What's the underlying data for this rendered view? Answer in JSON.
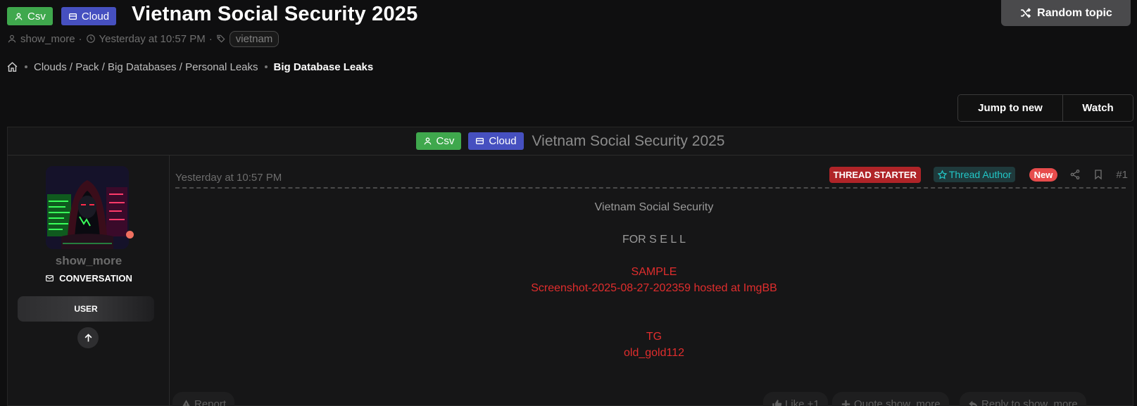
{
  "header": {
    "badges": [
      {
        "label": "Csv",
        "color": "#3fa84d",
        "icon": "user-icon"
      },
      {
        "label": "Cloud",
        "color": "#4650c0",
        "icon": "storage-icon"
      }
    ],
    "title": "Vietnam Social Security 2025",
    "random_topic_label": "Random topic"
  },
  "meta": {
    "author": "show_more",
    "separator": "·",
    "date": "Yesterday at 10:57 PM",
    "tag": "vietnam"
  },
  "breadcrumb": {
    "parent": "Clouds / Pack / Big Databases / Personal Leaks",
    "current": "Big Database Leaks"
  },
  "actions": {
    "jump_to_new": "Jump to new",
    "watch": "Watch"
  },
  "thread": {
    "badges": [
      {
        "label": "Csv",
        "color": "#3fa84d"
      },
      {
        "label": "Cloud",
        "color": "#4650c0"
      }
    ],
    "title": "Vietnam Social Security 2025"
  },
  "user": {
    "name": "show_more",
    "conversation_label": "CONVERSATION",
    "role": "USER",
    "status_color": "#f07060"
  },
  "post": {
    "date": "Yesterday at 10:57 PM",
    "thread_starter": "THREAD STARTER",
    "thread_author": "Thread Author",
    "new_label": "New",
    "number": "#1",
    "body": {
      "line1": "Vietnam Social Security",
      "line2": "FOR S E L L",
      "line3": "SAMPLE",
      "line4": "Screenshot-2025-08-27-202359 hosted at ImgBB",
      "line5": "TG",
      "line6": "old_gold112"
    },
    "footer": {
      "report": "Report",
      "like": "Like +1",
      "quote": "Quote show_more",
      "reply": "Reply to show_more"
    }
  }
}
